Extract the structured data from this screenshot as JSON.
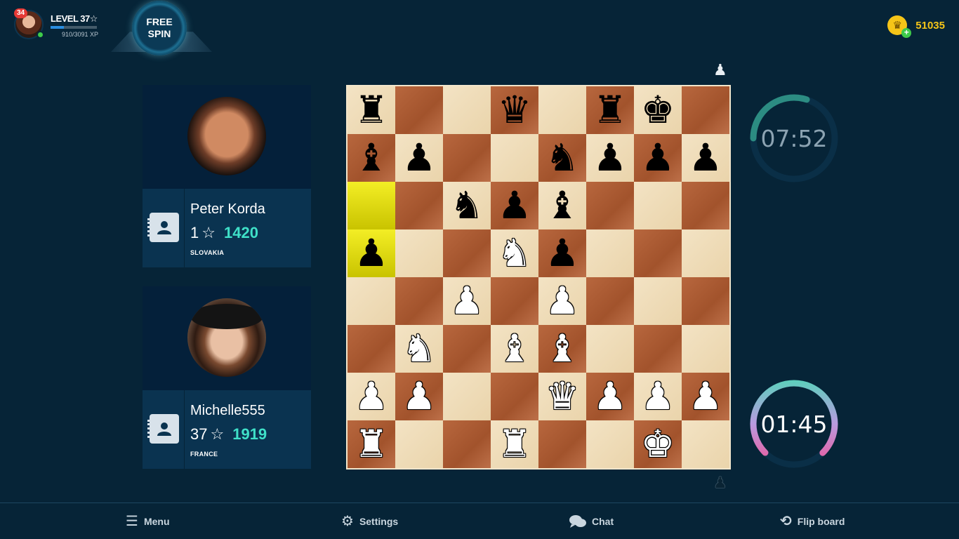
{
  "profile": {
    "notifications": "34",
    "level": "LEVEL 37",
    "level_star": "☆",
    "xp_text": "910/3091 XP",
    "xp_progress": 0.29
  },
  "free_spin": {
    "line1": "FREE",
    "line2": "SPIN"
  },
  "coins": {
    "amount": "51035",
    "icon": "crown-coin-icon"
  },
  "opponent": {
    "name": "Peter Korda",
    "level": "1",
    "star": "☆",
    "rating": "1420",
    "country": "SLOVAKIA"
  },
  "player": {
    "name": "Michelle555",
    "level": "37",
    "star": "☆",
    "rating": "1919",
    "country": "FRANCE"
  },
  "timers": {
    "opponent": {
      "time": "07:52",
      "remaining_fraction": 0.3
    },
    "player": {
      "time": "01:45",
      "remaining_fraction": 0.75
    }
  },
  "board": {
    "highlight": [
      "a6",
      "a5"
    ],
    "rows": [
      [
        "r",
        "",
        "",
        "q",
        "",
        "r",
        "k",
        ""
      ],
      [
        "b",
        "p",
        "",
        "",
        "n",
        "p",
        "p",
        "p"
      ],
      [
        "",
        "",
        "n",
        "p",
        "b",
        "",
        "",
        ""
      ],
      [
        "p",
        "",
        "",
        "N",
        "p",
        "",
        "",
        ""
      ],
      [
        "",
        "",
        "P",
        "",
        "P",
        "",
        "",
        ""
      ],
      [
        "",
        "N",
        "",
        "B",
        "B",
        "",
        "",
        ""
      ],
      [
        "P",
        "P",
        "",
        "",
        "Q",
        "P",
        "P",
        "P"
      ],
      [
        "R",
        "",
        "",
        "R",
        "",
        "",
        "K",
        ""
      ]
    ]
  },
  "bottom_bar": {
    "menu": "Menu",
    "settings": "Settings",
    "chat": "Chat",
    "flip": "Flip board"
  },
  "colors": {
    "background": "#062437",
    "panel": "#0a3350",
    "rating": "#3fe0c8",
    "coins": "#f5c518"
  }
}
